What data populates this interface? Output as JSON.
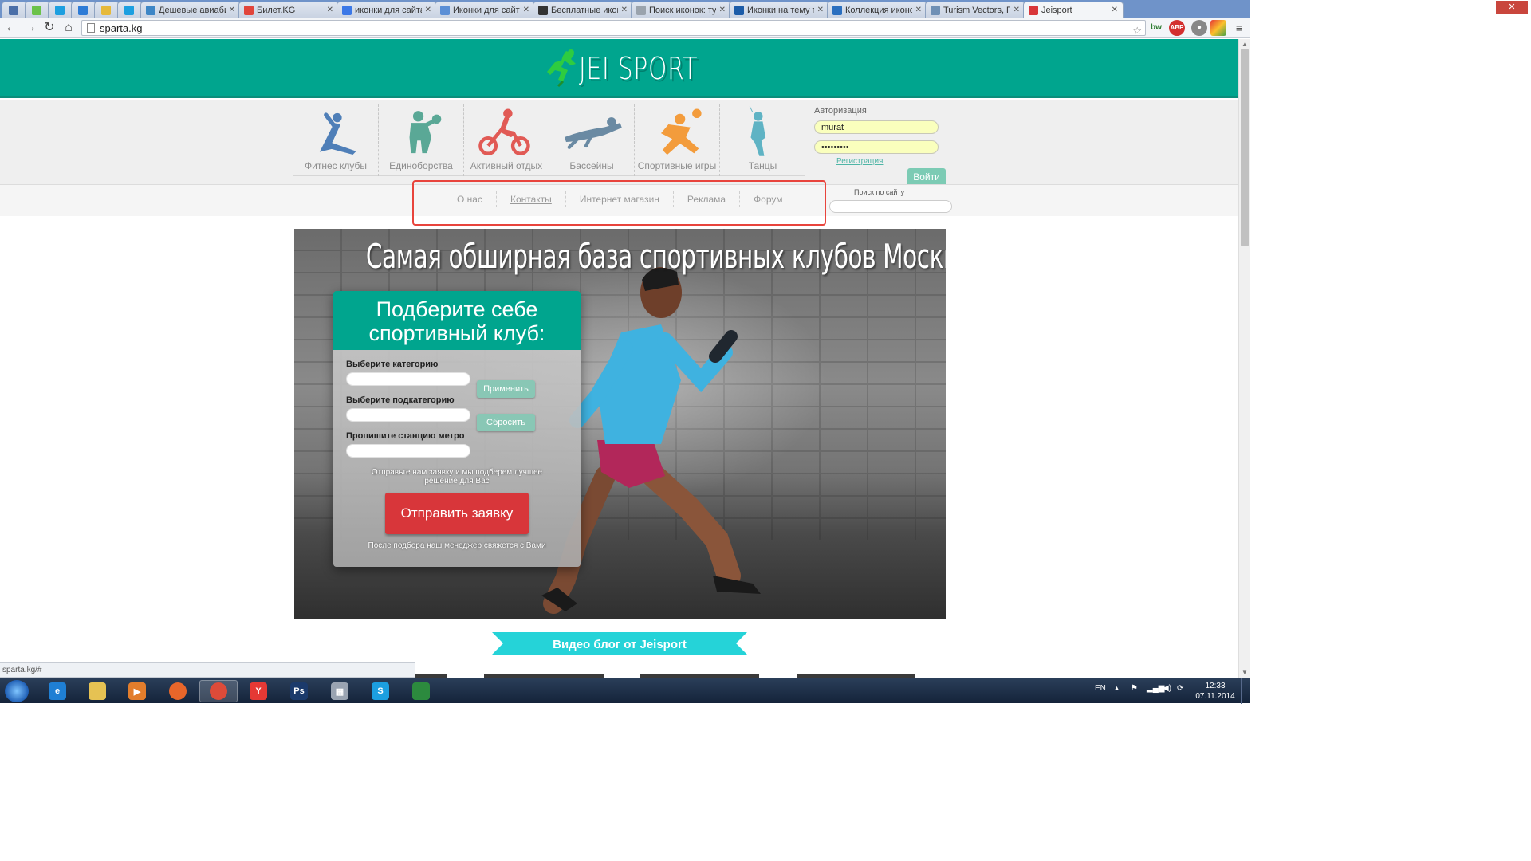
{
  "browser": {
    "tabs": [
      {
        "title": "",
        "icon": "globe-icon",
        "color": "#4b6fa8",
        "size": "small"
      },
      {
        "title": "",
        "icon": "green-app-icon",
        "color": "#6bc24a",
        "size": "small"
      },
      {
        "title": "",
        "icon": "skype-icon",
        "color": "#1c9fe0",
        "size": "small"
      },
      {
        "title": "",
        "icon": "blue-dot-icon",
        "color": "#2d7bd6",
        "size": "small"
      },
      {
        "title": "",
        "icon": "picture-icon",
        "color": "#e6b93b",
        "size": "small"
      },
      {
        "title": "",
        "icon": "skype-icon",
        "color": "#1c9fe0",
        "size": "small"
      },
      {
        "title": "Дешевые авиаби",
        "icon": "flight-icon",
        "color": "#3d86c6",
        "size": "wide"
      },
      {
        "title": "Билет.KG",
        "icon": "at-icon",
        "color": "#e1453b",
        "size": "wide"
      },
      {
        "title": "иконки для сайта",
        "icon": "google-icon",
        "color": "#3b78e7",
        "size": "wide"
      },
      {
        "title": "Иконки для сайта",
        "icon": "bird-icon",
        "color": "#5b8fd6",
        "size": "wide"
      },
      {
        "title": "Бесплатные икон",
        "icon": "circle-icon",
        "color": "#333333",
        "size": "wide"
      },
      {
        "title": "Поиск иконок: ту",
        "icon": "page-icon",
        "color": "#9aa3ad",
        "size": "wide"
      },
      {
        "title": "Иконки на тему т",
        "icon": "f-icon",
        "color": "#1c5ca8",
        "size": "wide"
      },
      {
        "title": "Коллекция иконо",
        "icon": "slash-icon",
        "color": "#2b6fbf",
        "size": "wide"
      },
      {
        "title": "Turism Vectors, Ph",
        "icon": "vector-icon",
        "color": "#6f90b5",
        "size": "wide"
      },
      {
        "title": "Jeisport",
        "icon": "jeisport-icon",
        "color": "#d8363a",
        "size": "wide",
        "active": true
      }
    ],
    "url": "sparta.kg",
    "status_url": "sparta.kg/#"
  },
  "site": {
    "logo_text": "JEI SPORT",
    "brand_color": "#00a58e",
    "categories": [
      {
        "label": "Фитнес клубы",
        "icon": "yoga-figure-icon",
        "color": "#4f7fb8"
      },
      {
        "label": "Единоборства",
        "icon": "boxer-figure-icon",
        "color": "#5aa896"
      },
      {
        "label": "Активный отдых",
        "icon": "cyclist-figure-icon",
        "color": "#e15a55"
      },
      {
        "label": "Бассейны",
        "icon": "swimmer-figure-icon",
        "color": "#6a8aa3"
      },
      {
        "label": "Спортивные игры",
        "icon": "football-player-icon",
        "color": "#f39c3c"
      },
      {
        "label": "Танцы",
        "icon": "dancer-figure-icon",
        "color": "#5fb3c4"
      }
    ],
    "auth": {
      "title": "Авторизация",
      "login_value": "murat",
      "password_value": "•••••••••",
      "register_label": "Регистрация",
      "login_button": "Войти"
    },
    "menu": [
      {
        "label": "О нас",
        "link": false
      },
      {
        "label": "Контакты",
        "link": true
      },
      {
        "label": "Интернет магазин",
        "link": false
      },
      {
        "label": "Реклама",
        "link": false
      },
      {
        "label": "Форум",
        "link": false
      }
    ],
    "search_label": "Поиск по сайту",
    "hero": {
      "title": "Самая обширная база спортивных клубов Москвы!",
      "form_title_line1": "Подберите себе",
      "form_title_line2": "спортивный клуб:",
      "category_label": "Выберите категорию",
      "subcategory_label": "Выберите подкатегорию",
      "metro_label": "Пропишите станцию метро",
      "apply_button": "Применить",
      "reset_button": "Сбросить",
      "note": "Отправьте нам заявку и мы подберем лучшее решение для Вас",
      "send_button": "Отправить заявку",
      "footer_note": "После подбора наш менеджер свяжется с Вами"
    },
    "video_blog_title": "Видео блог от Jeisport",
    "ribbon_color": "#25d3d8"
  },
  "taskbar": {
    "apps": [
      {
        "name": "ie",
        "icon": "internet-explorer-icon",
        "color": "#1f7fd4",
        "glyph": "e"
      },
      {
        "name": "explorer",
        "icon": "folder-icon",
        "color": "#e6c253",
        "glyph": ""
      },
      {
        "name": "media",
        "icon": "media-player-icon",
        "color": "#e27d2c",
        "glyph": "▶"
      },
      {
        "name": "firefox",
        "icon": "firefox-icon",
        "color": "#e8662a",
        "glyph": ""
      },
      {
        "name": "chrome",
        "icon": "chrome-icon",
        "color": "#dd4b39",
        "glyph": "",
        "active": true
      },
      {
        "name": "yandex",
        "icon": "yandex-browser-icon",
        "color": "#e53935",
        "glyph": "Y"
      },
      {
        "name": "photoshop",
        "icon": "photoshop-icon",
        "color": "#1b3a6b",
        "glyph": "Ps"
      },
      {
        "name": "calc",
        "icon": "calculator-icon",
        "color": "#9aa4b2",
        "glyph": "▦"
      },
      {
        "name": "skype",
        "icon": "skype-icon",
        "color": "#1c9fe0",
        "glyph": "S"
      },
      {
        "name": "app",
        "icon": "leaf-app-icon",
        "color": "#2c8a3e",
        "glyph": ""
      }
    ],
    "language": "EN",
    "time": "12:33",
    "date": "07.11.2014"
  }
}
